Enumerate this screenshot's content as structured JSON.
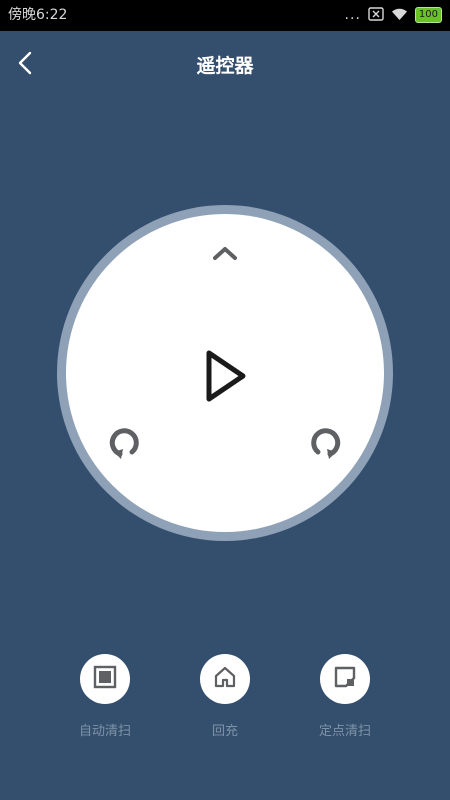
{
  "status_bar": {
    "time": "傍晚6:22",
    "dots": "...",
    "battery": "100"
  },
  "header": {
    "title": "遥控器"
  },
  "dial": {
    "up_icon": "chevron-up-icon",
    "play_icon": "play-icon",
    "rotate_left_icon": "rotate-left-icon",
    "rotate_right_icon": "rotate-right-icon"
  },
  "actions": [
    {
      "label": "自动清扫",
      "icon": "square-icon"
    },
    {
      "label": "回充",
      "icon": "home-icon"
    },
    {
      "label": "定点清扫",
      "icon": "spot-icon"
    }
  ],
  "colors": {
    "background": "#334f6d",
    "dial_ring": "#8ea1b6",
    "icon_gray": "#5f6063",
    "label_gray": "#7f93a8",
    "battery_green": "#69c22a"
  }
}
